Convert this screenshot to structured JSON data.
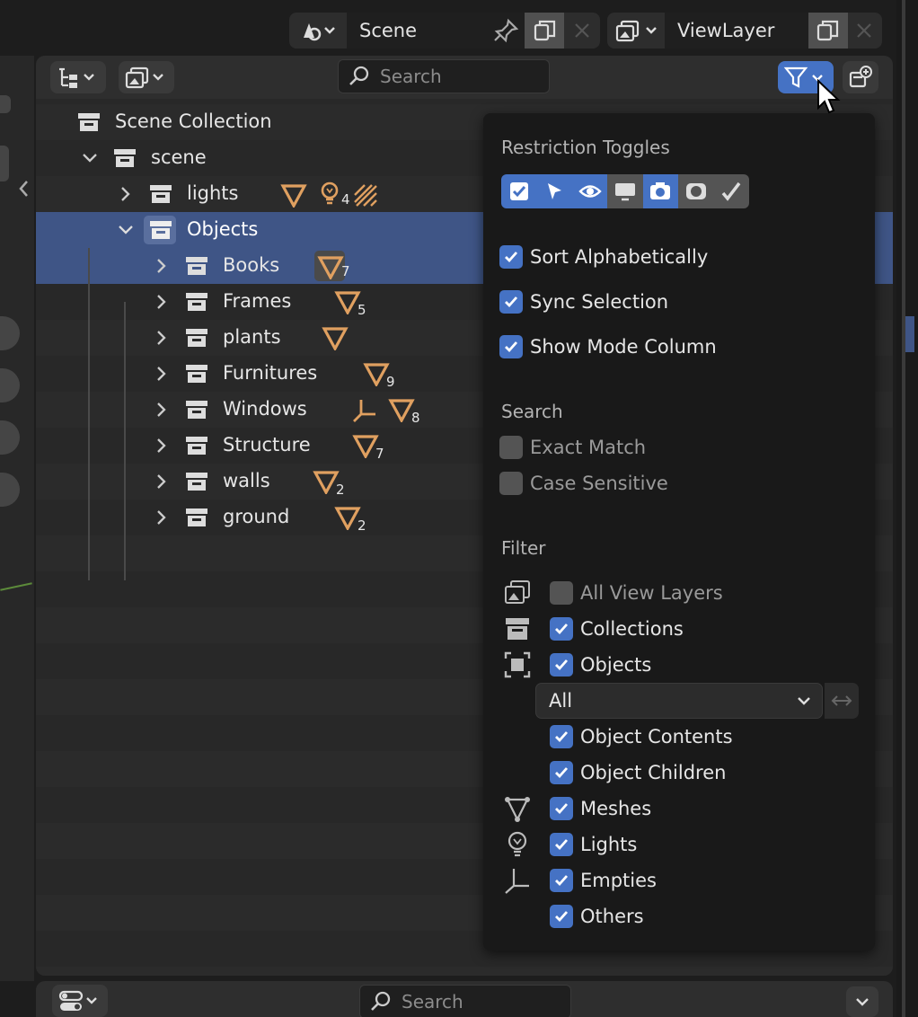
{
  "topbar": {
    "scene_label": "Scene",
    "viewlayer_label": "ViewLayer"
  },
  "header": {
    "search_placeholder": "Search"
  },
  "tree": {
    "scene_collection": "Scene Collection",
    "scene": "scene",
    "lights": {
      "label": "lights",
      "light_count": "4"
    },
    "objects": "Objects",
    "children": [
      {
        "label": "Books",
        "count": "7"
      },
      {
        "label": "Frames",
        "count": "5"
      },
      {
        "label": "plants",
        "count": ""
      },
      {
        "label": "Furnitures",
        "count": "9"
      },
      {
        "label": "Windows",
        "count": "8"
      },
      {
        "label": "Structure",
        "count": "7"
      },
      {
        "label": "walls",
        "count": "2"
      },
      {
        "label": "ground",
        "count": "2"
      }
    ]
  },
  "popup": {
    "restriction_title": "Restriction Toggles",
    "sort_alpha": "Sort Alphabetically",
    "sync_selection": "Sync Selection",
    "show_mode": "Show Mode Column",
    "search_title": "Search",
    "exact_match": "Exact Match",
    "case_sensitive": "Case Sensitive",
    "filter_title": "Filter",
    "all_view_layers": "All View Layers",
    "collections": "Collections",
    "objects": "Objects",
    "object_filter_value": "All",
    "object_contents": "Object Contents",
    "object_children": "Object Children",
    "meshes": "Meshes",
    "lights": "Lights",
    "empties": "Empties",
    "others": "Others"
  },
  "bottom": {
    "search_placeholder": "Search"
  },
  "colors": {
    "accent": "#4572c4",
    "selection": "#3f5586",
    "mesh_orange": "#e0a060"
  }
}
